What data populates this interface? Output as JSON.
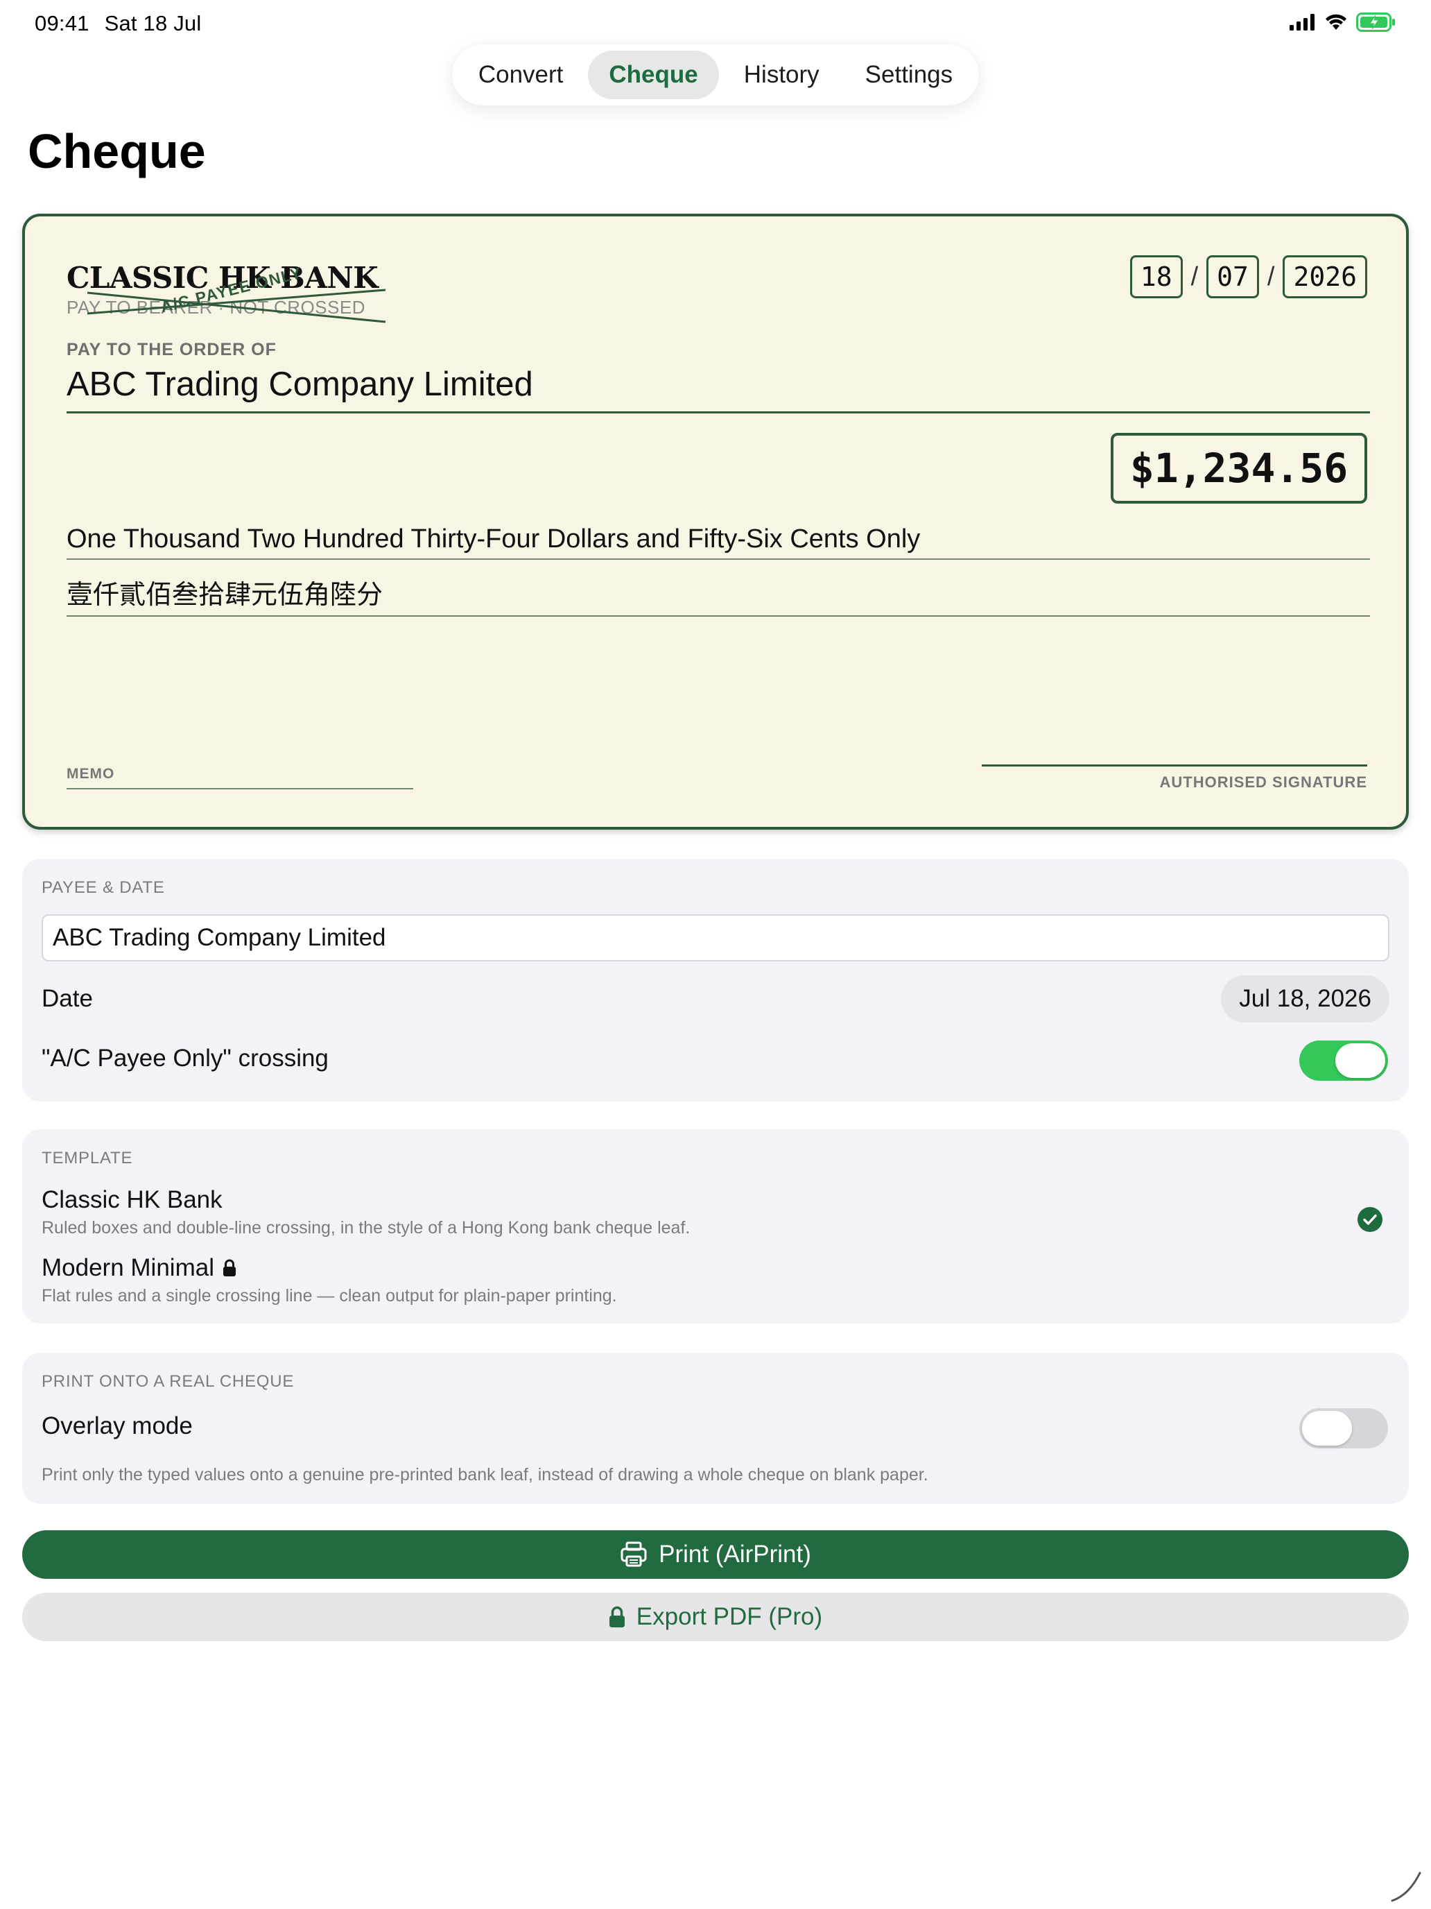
{
  "status_bar": {
    "time": "09:41",
    "date": "Sat 18 Jul",
    "battery_color": "#34c759"
  },
  "tabs": [
    {
      "label": "Convert",
      "active": false
    },
    {
      "label": "Cheque",
      "active": true
    },
    {
      "label": "History",
      "active": false
    },
    {
      "label": "Settings",
      "active": false
    }
  ],
  "page_title": "Cheque",
  "cheque": {
    "bank_name": "CLASSIC HK BANK",
    "bearer_text": "PAY TO BEARER · NOT CROSSED",
    "crossing_text": "A/C PAYEE ONLY",
    "date_day": "18",
    "date_month": "07",
    "date_year": "2026",
    "date_sep": "/",
    "pay_label": "PAY TO THE ORDER OF",
    "payee": "ABC Trading Company Limited",
    "amount": "$1,234.56",
    "words_en": "One Thousand Two Hundred Thirty-Four Dollars and Fifty-Six Cents Only",
    "words_zh": "壹仟貳佰叁拾肆元伍角陸分",
    "memo_label": "MEMO",
    "signature_label": "AUTHORISED SIGNATURE",
    "accent_color": "#2d5a3a",
    "paper_color": "#f8f5e4"
  },
  "payee_date": {
    "header": "PAYEE & DATE",
    "payee_value": "ABC Trading Company Limited",
    "date_label": "Date",
    "date_value": "Jul 18, 2026",
    "crossing_label": "\"A/C Payee Only\" crossing",
    "crossing_on": true
  },
  "template": {
    "header": "TEMPLATE",
    "options": [
      {
        "title": "Classic HK Bank",
        "desc": "Ruled boxes and double-line crossing, in the style of a Hong Kong bank cheque leaf.",
        "selected": true,
        "locked": false
      },
      {
        "title": "Modern Minimal",
        "desc": "Flat rules and a single crossing line — clean output for plain-paper printing.",
        "selected": false,
        "locked": true
      }
    ]
  },
  "overlay": {
    "header": "PRINT ONTO A REAL CHEQUE",
    "label": "Overlay mode",
    "on": false,
    "desc": "Print only the typed values onto a genuine pre-printed bank leaf, instead of drawing a whole cheque on blank paper."
  },
  "buttons": {
    "print_label": "Print (AirPrint)",
    "export_label": "Export PDF (Pro)",
    "primary_color": "#226b40"
  }
}
